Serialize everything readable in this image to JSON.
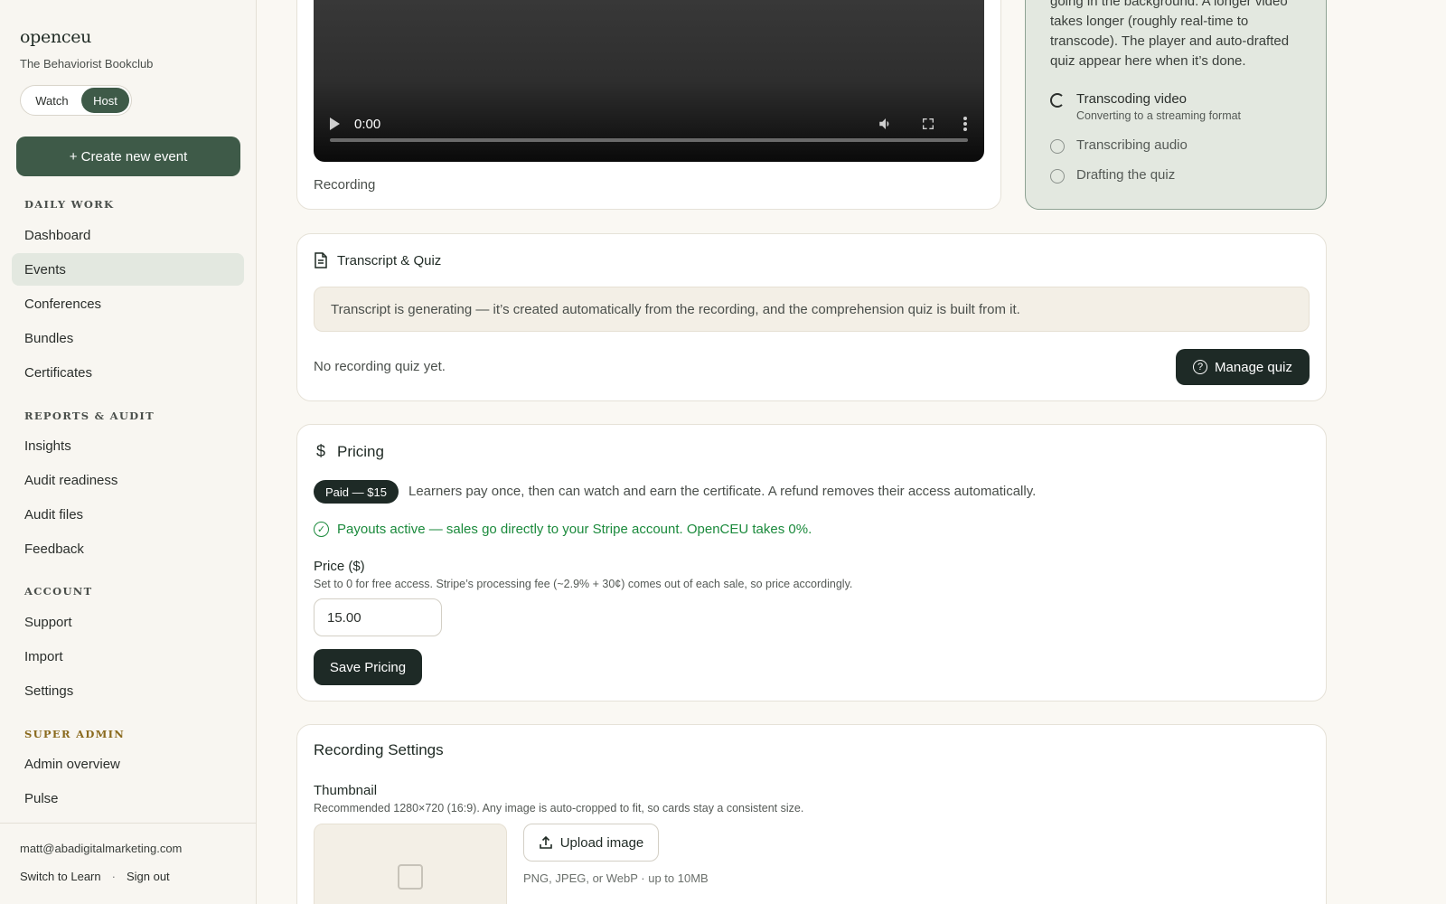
{
  "sidebar": {
    "brand": "openceu",
    "org": "The Behaviorist Bookclub",
    "toggle": {
      "watch": "Watch",
      "host": "Host",
      "active": "Host"
    },
    "create_button": "+ Create new event",
    "sections": [
      {
        "label": "DAILY WORK",
        "items": [
          "Dashboard",
          "Events",
          "Conferences",
          "Bundles",
          "Certificates"
        ]
      },
      {
        "label": "REPORTS & AUDIT",
        "items": [
          "Insights",
          "Audit readiness",
          "Audit files",
          "Feedback"
        ]
      },
      {
        "label": "ACCOUNT",
        "items": [
          "Support",
          "Import",
          "Settings"
        ]
      },
      {
        "label": "SUPER ADMIN",
        "items": [
          "Admin overview",
          "Pulse"
        ]
      }
    ],
    "active_item": "Events",
    "footer": {
      "email": "matt@abadigitalmarketing.com",
      "switch": "Switch to Learn",
      "separator": "·",
      "signout": "Sign out"
    }
  },
  "video": {
    "time": "0:00",
    "caption": "Recording"
  },
  "processing": {
    "text": "going in the background. A longer video takes longer (roughly real-time to transcode). The player and auto-drafted quiz appear here when it’s done.",
    "steps": [
      {
        "title": "Transcoding video",
        "subtitle": "Converting to a streaming format",
        "state": "active"
      },
      {
        "title": "Transcribing audio",
        "state": "pending"
      },
      {
        "title": "Drafting the quiz",
        "state": "pending"
      }
    ]
  },
  "transcript": {
    "title": "Transcript & Quiz",
    "notice": "Transcript is generating — it’s created automatically from the recording, and the comprehension quiz is built from it.",
    "empty": "No recording quiz yet.",
    "manage_button": "Manage quiz",
    "help_glyph": "?"
  },
  "pricing": {
    "title": "Pricing",
    "currency_glyph": "$",
    "badge": "Paid — $15",
    "description": "Learners pay once, then can watch and earn the certificate. A refund removes their access automatically.",
    "payouts": "Payouts active — sales go directly to your Stripe account. OpenCEU takes 0%.",
    "check_glyph": "✓",
    "price_label": "Price ($)",
    "price_help": "Set to 0 for free access. Stripe’s processing fee (~2.9% + 30¢) comes out of each sale, so price accordingly.",
    "price_value": "15.00",
    "save_button": "Save Pricing"
  },
  "recording_settings": {
    "title": "Recording Settings",
    "thumbnail_label": "Thumbnail",
    "thumbnail_help": "Recommended 1280×720 (16:9). Any image is auto-cropped to fit, so cards stay a consistent size.",
    "upload_button": "Upload image",
    "upload_help": "PNG, JPEG, or WebP · up to 10MB"
  },
  "colors": {
    "accent": "#3e5a48",
    "dark": "#1e2a26",
    "success": "#1b8a3c",
    "super_admin": "#8a6a1e"
  }
}
